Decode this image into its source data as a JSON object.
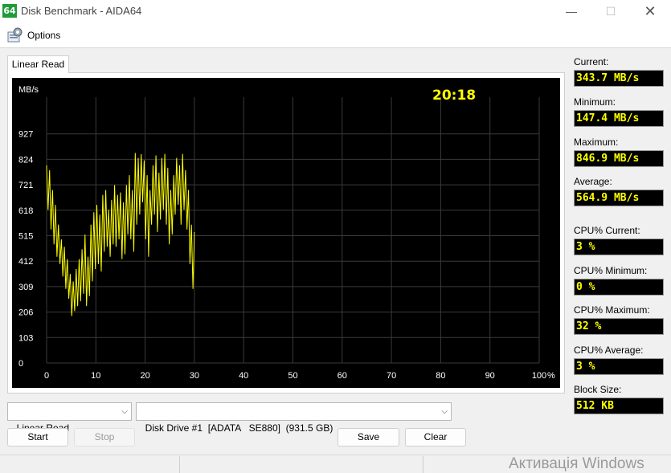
{
  "window": {
    "title": "Disk Benchmark - AIDA64",
    "icon_text": "64",
    "minimize": "—",
    "maximize": "☐",
    "close": "✕"
  },
  "menu": {
    "options_label": "Options"
  },
  "tab": {
    "label": "Linear Read"
  },
  "graph": {
    "time": "20:18",
    "y_unit": "MB/s",
    "x_unit": "%",
    "colors": {
      "background": "#000000",
      "grid": "#3a3a3a",
      "line": "#ffff00",
      "text": "#ffffff",
      "time": "#ffff00"
    }
  },
  "chart_data": {
    "type": "line",
    "title": "",
    "xlabel": "%",
    "ylabel": "MB/s",
    "xlim": [
      0,
      100
    ],
    "ylim": [
      0,
      1030
    ],
    "x_ticks": [
      "0",
      "10",
      "20",
      "30",
      "40",
      "50",
      "60",
      "70",
      "80",
      "90",
      "100"
    ],
    "y_ticks": [
      "0",
      "103",
      "206",
      "309",
      "412",
      "515",
      "618",
      "721",
      "824",
      "927"
    ],
    "grid": true,
    "series": [
      {
        "values": [
          [
            0.0,
            800
          ],
          [
            0.3,
            620
          ],
          [
            0.6,
            780
          ],
          [
            0.9,
            540
          ],
          [
            1.2,
            700
          ],
          [
            1.5,
            480
          ],
          [
            1.8,
            640
          ],
          [
            2.1,
            430
          ],
          [
            2.4,
            560
          ],
          [
            2.7,
            400
          ],
          [
            3.0,
            500
          ],
          [
            3.3,
            350
          ],
          [
            3.6,
            470
          ],
          [
            3.9,
            300
          ],
          [
            4.2,
            420
          ],
          [
            4.5,
            260
          ],
          [
            4.8,
            360
          ],
          [
            5.1,
            190
          ],
          [
            5.4,
            330
          ],
          [
            5.7,
            210
          ],
          [
            6.0,
            380
          ],
          [
            6.3,
            230
          ],
          [
            6.6,
            420
          ],
          [
            6.9,
            250
          ],
          [
            7.2,
            460
          ],
          [
            7.5,
            280
          ],
          [
            7.8,
            520
          ],
          [
            8.1,
            230
          ],
          [
            8.4,
            430
          ],
          [
            8.7,
            270
          ],
          [
            9.0,
            560
          ],
          [
            9.3,
            330
          ],
          [
            9.6,
            610
          ],
          [
            9.9,
            380
          ],
          [
            10.2,
            640
          ],
          [
            10.5,
            400
          ],
          [
            10.8,
            600
          ],
          [
            11.1,
            370
          ],
          [
            11.4,
            680
          ],
          [
            11.7,
            450
          ],
          [
            12.0,
            700
          ],
          [
            12.3,
            470
          ],
          [
            12.6,
            620
          ],
          [
            12.9,
            430
          ],
          [
            13.2,
            660
          ],
          [
            13.5,
            480
          ],
          [
            13.8,
            720
          ],
          [
            14.1,
            470
          ],
          [
            14.4,
            680
          ],
          [
            14.7,
            500
          ],
          [
            15.0,
            690
          ],
          [
            15.3,
            420
          ],
          [
            15.6,
            650
          ],
          [
            15.9,
            440
          ],
          [
            16.2,
            720
          ],
          [
            16.5,
            520
          ],
          [
            16.8,
            760
          ],
          [
            17.1,
            500
          ],
          [
            17.4,
            700
          ],
          [
            17.7,
            450
          ],
          [
            18.0,
            850
          ],
          [
            18.3,
            560
          ],
          [
            18.6,
            830
          ],
          [
            18.9,
            600
          ],
          [
            19.2,
            845
          ],
          [
            19.5,
            650
          ],
          [
            19.8,
            820
          ],
          [
            20.1,
            500
          ],
          [
            20.4,
            760
          ],
          [
            20.7,
            430
          ],
          [
            21.0,
            700
          ],
          [
            21.3,
            560
          ],
          [
            21.6,
            800
          ],
          [
            21.9,
            600
          ],
          [
            22.2,
            840
          ],
          [
            22.5,
            530
          ],
          [
            22.8,
            770
          ],
          [
            23.1,
            580
          ],
          [
            23.4,
            830
          ],
          [
            23.7,
            620
          ],
          [
            24.0,
            846
          ],
          [
            24.3,
            560
          ],
          [
            24.6,
            790
          ],
          [
            24.9,
            480
          ],
          [
            25.2,
            700
          ],
          [
            25.5,
            520
          ],
          [
            25.8,
            760
          ],
          [
            26.1,
            600
          ],
          [
            26.4,
            830
          ],
          [
            26.7,
            640
          ],
          [
            27.0,
            800
          ],
          [
            27.3,
            560
          ],
          [
            27.6,
            846
          ],
          [
            27.9,
            620
          ],
          [
            28.2,
            780
          ],
          [
            28.5,
            540
          ],
          [
            28.8,
            700
          ],
          [
            29.1,
            400
          ],
          [
            29.4,
            560
          ],
          [
            29.7,
            300
          ],
          [
            30.0,
            530
          ]
        ]
      }
    ]
  },
  "stats": [
    {
      "label": "Current:",
      "value": "343.7 MB/s"
    },
    {
      "label": "Minimum:",
      "value": "147.4 MB/s"
    },
    {
      "label": "Maximum:",
      "value": "846.9 MB/s"
    },
    {
      "label": "Average:",
      "value": "564.9 MB/s"
    },
    {
      "label": "CPU% Current:",
      "value": "3 %"
    },
    {
      "label": "CPU% Minimum:",
      "value": "0 %"
    },
    {
      "label": "CPU% Maximum:",
      "value": "32 %"
    },
    {
      "label": "CPU% Average:",
      "value": "3 %"
    },
    {
      "label": "Block Size:",
      "value": "512 KB"
    }
  ],
  "controls": {
    "test_select": "Linear Read",
    "drive_select": "Disk Drive #1  [ADATA   SE880]  (931.5 GB)",
    "start": "Start",
    "stop": "Stop",
    "save": "Save",
    "clear": "Clear"
  },
  "watermark": "Активація Windows"
}
